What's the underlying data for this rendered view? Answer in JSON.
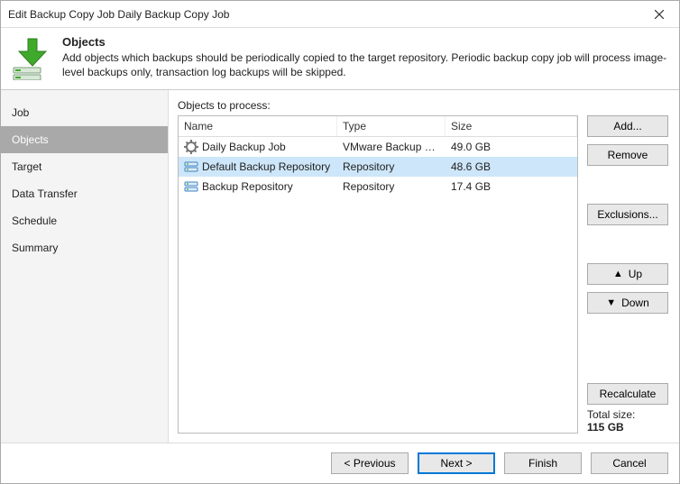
{
  "window": {
    "title": "Edit Backup Copy Job Daily Backup Copy Job"
  },
  "header": {
    "heading": "Objects",
    "description": "Add objects which backups should be periodically copied to the target repository. Periodic backup copy job will process image-level backups only, transaction log backups will be skipped."
  },
  "sidebar": {
    "items": [
      {
        "label": "Job",
        "selected": false
      },
      {
        "label": "Objects",
        "selected": true
      },
      {
        "label": "Target",
        "selected": false
      },
      {
        "label": "Data Transfer",
        "selected": false
      },
      {
        "label": "Schedule",
        "selected": false
      },
      {
        "label": "Summary",
        "selected": false
      }
    ]
  },
  "objects": {
    "label": "Objects to process:",
    "columns": {
      "name": "Name",
      "type": "Type",
      "size": "Size"
    },
    "rows": [
      {
        "icon": "gear",
        "name": "Daily Backup Job",
        "type": "VMware Backup Job",
        "size": "49.0 GB",
        "selected": false
      },
      {
        "icon": "repo",
        "name": "Default Backup Repository",
        "type": "Repository",
        "size": "48.6 GB",
        "selected": true
      },
      {
        "icon": "repo",
        "name": "Backup Repository",
        "type": "Repository",
        "size": "17.4 GB",
        "selected": false
      }
    ]
  },
  "side_buttons": {
    "add": "Add...",
    "remove": "Remove",
    "exclusions": "Exclusions...",
    "up": "Up",
    "down": "Down",
    "recalculate": "Recalculate"
  },
  "total": {
    "label": "Total size:",
    "value": "115 GB"
  },
  "footer": {
    "previous": "< Previous",
    "next": "Next >",
    "finish": "Finish",
    "cancel": "Cancel"
  }
}
